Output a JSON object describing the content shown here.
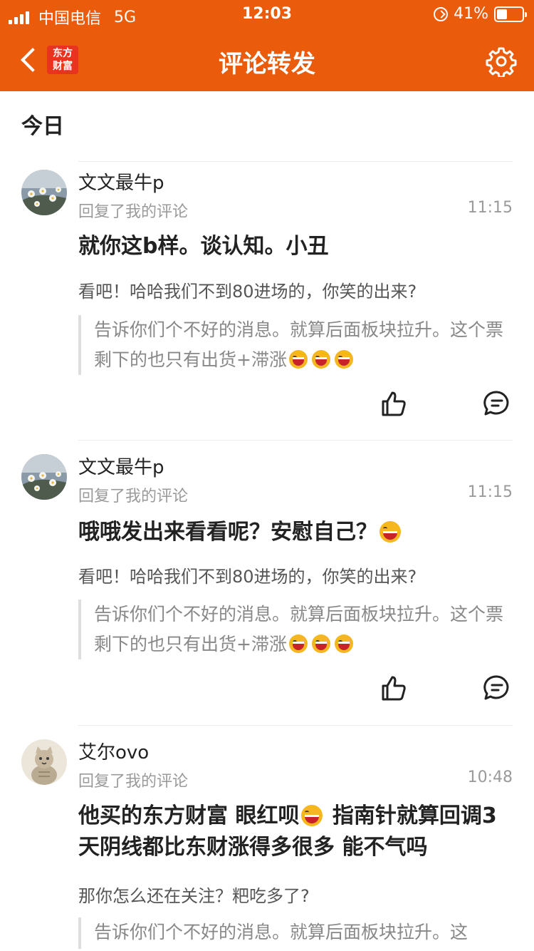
{
  "status_bar": {
    "carrier": "中国电信",
    "network": "5G",
    "time": "12:03",
    "battery": "41%",
    "battery_level": 0.41
  },
  "nav": {
    "logo_line1": "东方",
    "logo_line2": "财富",
    "title": "评论转发",
    "accent_color": "#ea5b0c"
  },
  "section_label": "今日",
  "items": [
    {
      "username": "文文最牛p",
      "reply_hint": "回复了我的评论",
      "time": "11:15",
      "main_text": "就你这b样。谈认知。小丑",
      "sub_text": "看吧！哈哈我们不到80进场的，你笑的出来?",
      "quote_text": "告诉你们个不好的消息。就算后面板块拉升。这个票剩下的也只有出货+滞涨"
    },
    {
      "username": "文文最牛p",
      "reply_hint": "回复了我的评论",
      "time": "11:15",
      "main_text": "哦哦发出来看看呢？安慰自己？",
      "sub_text": "看吧！哈哈我们不到80进场的，你笑的出来?",
      "quote_text": "告诉你们个不好的消息。就算后面板块拉升。这个票剩下的也只有出货+滞涨"
    },
    {
      "username": "艾尔ovo",
      "reply_hint": "回复了我的评论",
      "time": "10:48",
      "main_text_part1": "他买的东方财富 眼红呗",
      "main_text_part2": " 指南针就算回调3天阴线都比东财涨得多很多 能不气吗",
      "sub_text": "那你怎么还在关注？粑吃多了?",
      "quote_text": "告诉你们个不好的消息。就算后面板块拉升。这"
    }
  ]
}
